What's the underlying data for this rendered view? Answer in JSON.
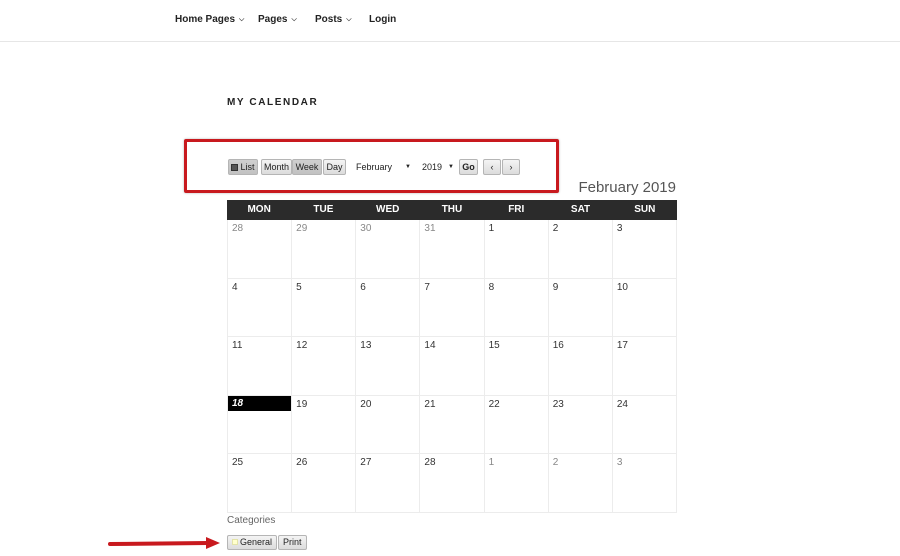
{
  "nav": {
    "items": [
      {
        "label": "Home Pages",
        "has_submenu": true
      },
      {
        "label": "Pages",
        "has_submenu": true
      },
      {
        "label": "Posts",
        "has_submenu": true
      },
      {
        "label": "Login",
        "has_submenu": false
      }
    ]
  },
  "page": {
    "title": "MY CALENDAR"
  },
  "toolbar": {
    "list_label": "List",
    "month_label": "Month",
    "week_label": "Week",
    "day_label": "Day",
    "month_select": "February",
    "year_select": "2019",
    "go_label": "Go",
    "prev_label": "‹",
    "next_label": "›"
  },
  "calendar": {
    "heading": "February 2019",
    "weekdays": [
      "MON",
      "TUE",
      "WED",
      "THU",
      "FRI",
      "SAT",
      "SUN"
    ],
    "weeks": [
      [
        "28",
        "29",
        "30",
        "31",
        "1",
        "2",
        "3"
      ],
      [
        "4",
        "5",
        "6",
        "7",
        "8",
        "9",
        "10"
      ],
      [
        "11",
        "12",
        "13",
        "14",
        "15",
        "16",
        "17"
      ],
      [
        "18",
        "19",
        "20",
        "21",
        "22",
        "23",
        "24"
      ],
      [
        "25",
        "26",
        "27",
        "28",
        "1",
        "2",
        "3"
      ]
    ],
    "today": "18"
  },
  "categories": {
    "label": "Categories",
    "general_label": "General",
    "general_color": "#ffffcc",
    "print_label": "Print"
  },
  "colors": {
    "highlight": "#c8191e",
    "header_bg": "#2b2b2b"
  }
}
